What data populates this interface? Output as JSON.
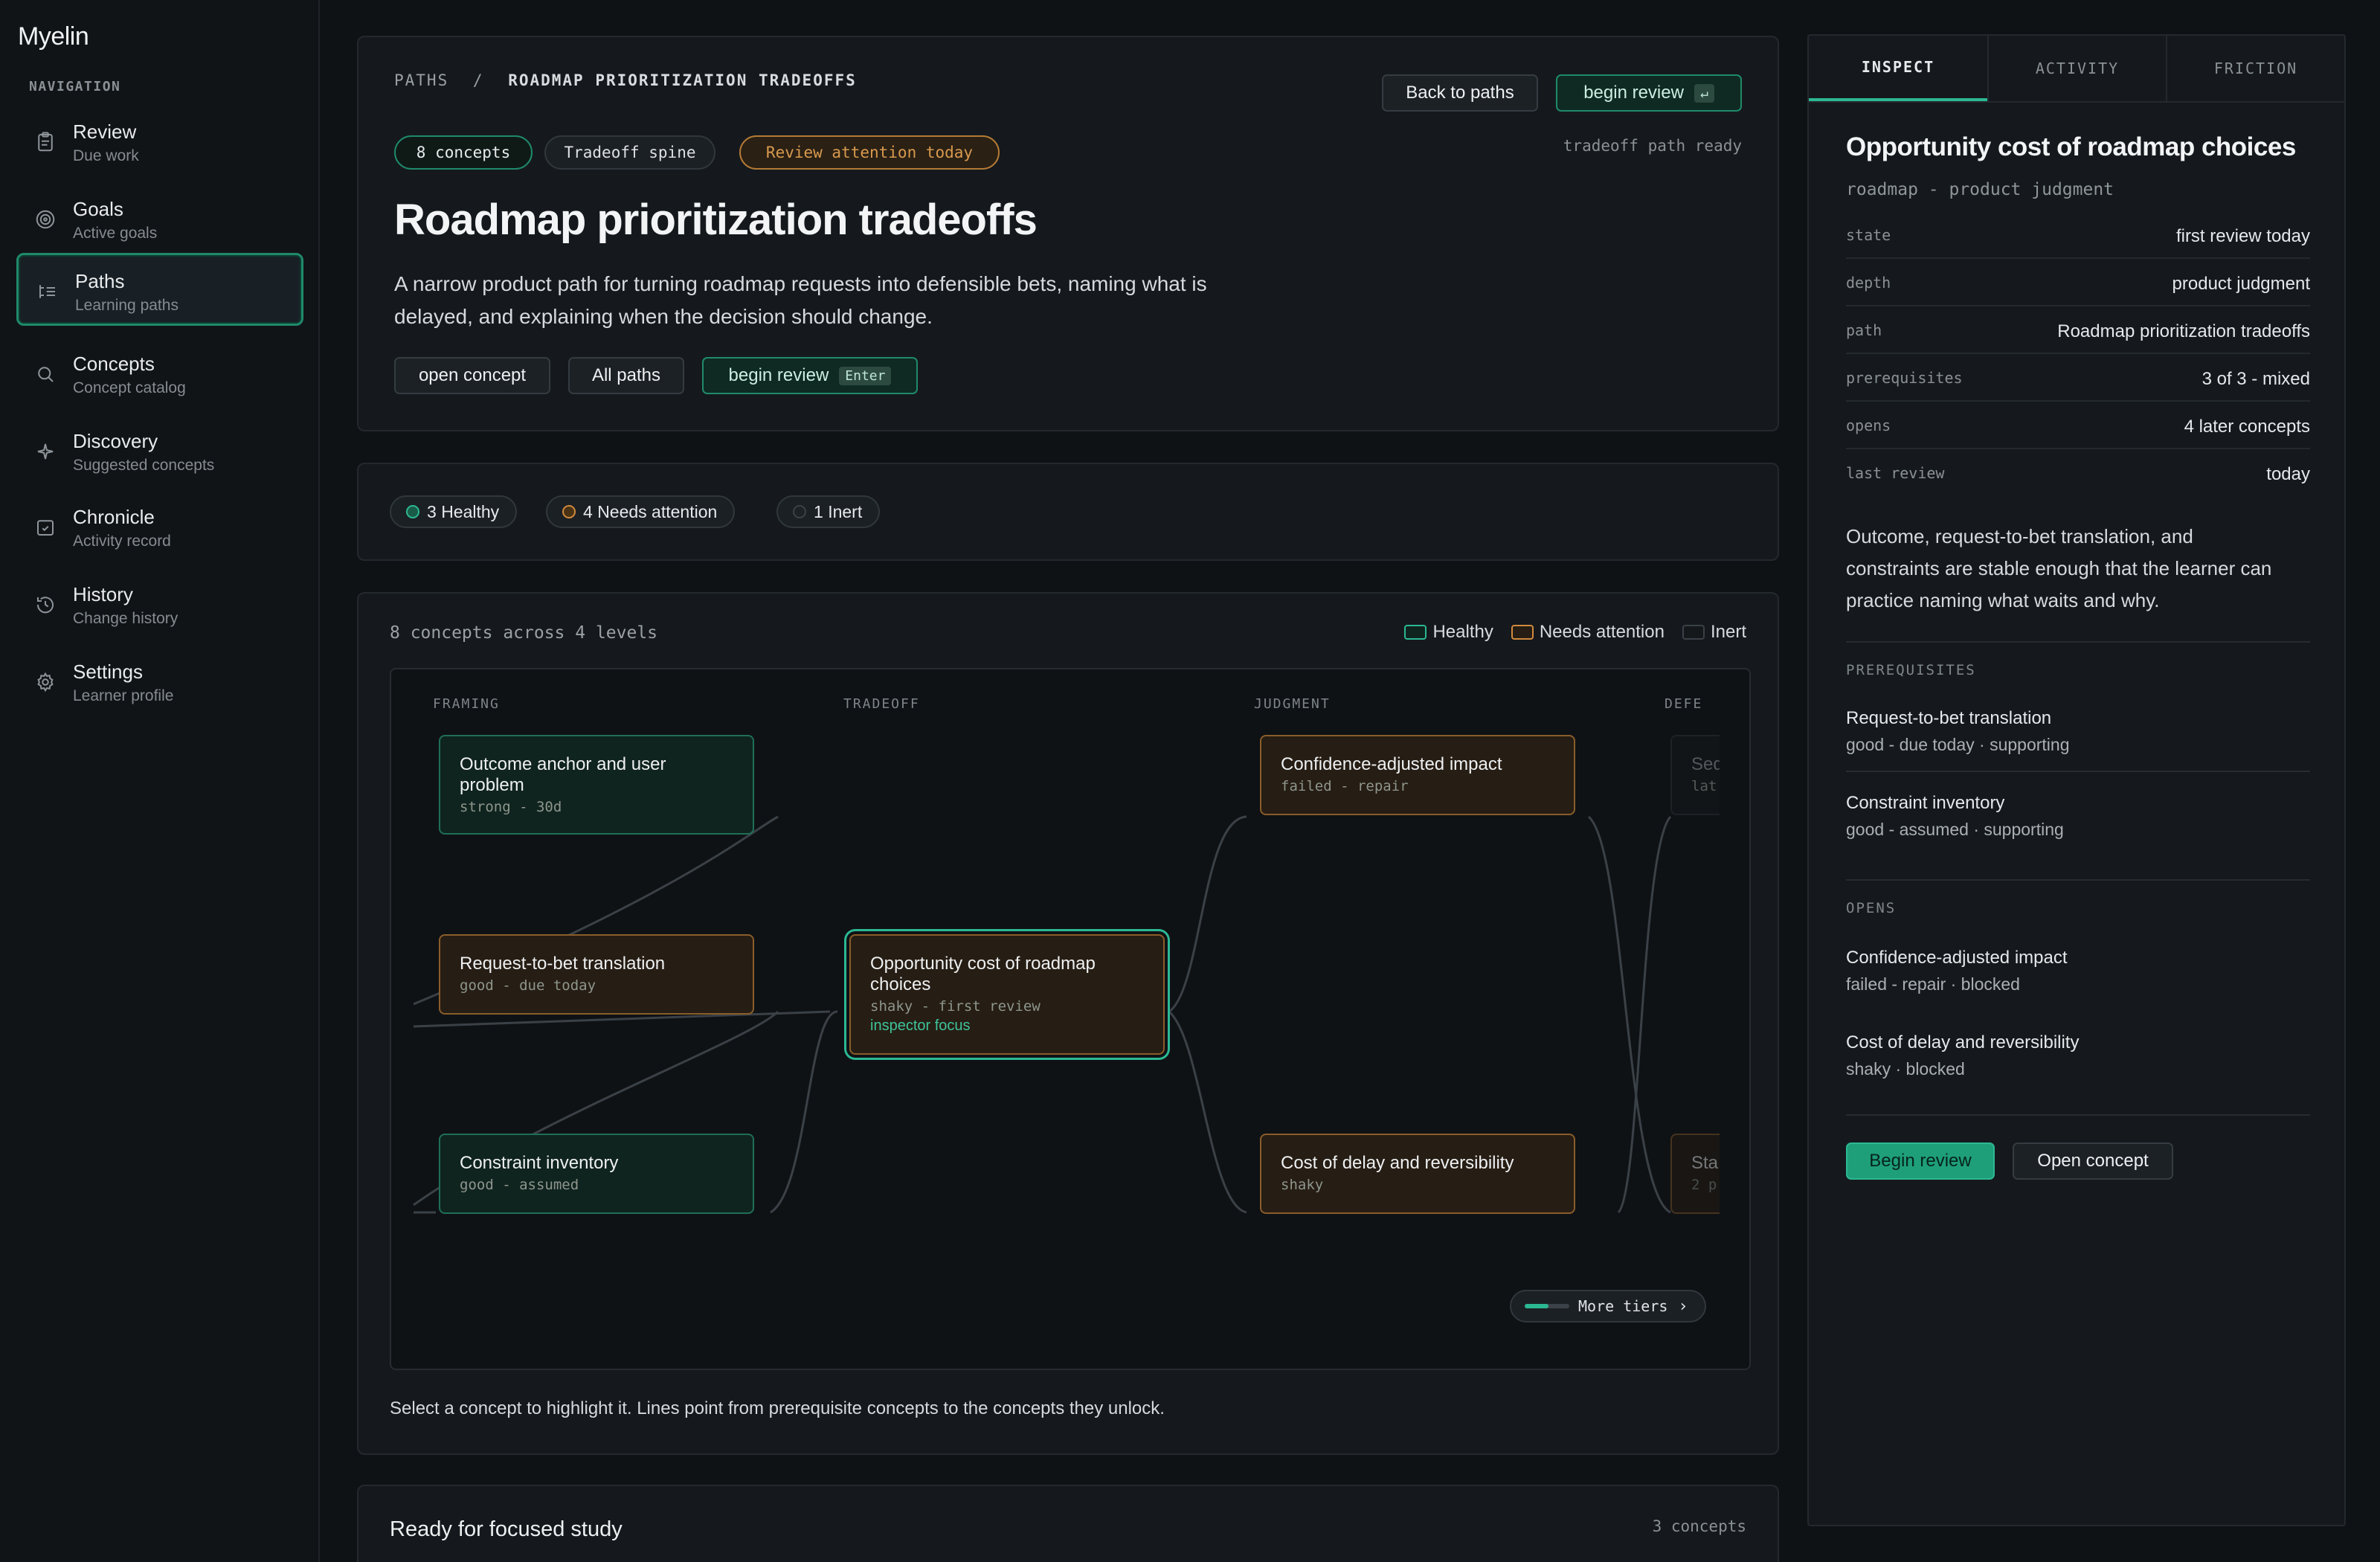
{
  "app": {
    "name": "Myelin"
  },
  "sidebar": {
    "heading": "NAVIGATION",
    "items": [
      {
        "label": "Review",
        "sub": "Due work"
      },
      {
        "label": "Goals",
        "sub": "Active goals"
      },
      {
        "label": "Paths",
        "sub": "Learning paths"
      },
      {
        "label": "Concepts",
        "sub": "Concept catalog"
      },
      {
        "label": "Discovery",
        "sub": "Suggested concepts"
      },
      {
        "label": "Chronicle",
        "sub": "Activity record"
      },
      {
        "label": "History",
        "sub": "Change history"
      },
      {
        "label": "Settings",
        "sub": "Learner profile"
      }
    ]
  },
  "header": {
    "breadcrumb_root": "PATHS",
    "breadcrumb_sep": "/",
    "breadcrumb_current": "ROADMAP PRIORITIZATION TRADEOFFS",
    "back_label": "Back to paths",
    "begin_label": "begin review",
    "begin_key": "↵",
    "status_text": "tradeoff path ready",
    "chips": [
      "8 concepts",
      "Tradeoff spine",
      "Review attention today"
    ],
    "title": "Roadmap prioritization tradeoffs",
    "description_1": "A narrow product path for turning roadmap requests into defensible bets, naming what is",
    "description_2": "delayed, and explaining when the decision should change.",
    "open_concept_label": "open concept",
    "all_paths_label": "All paths",
    "begin_review_label": "begin review",
    "begin_review_key": "Enter"
  },
  "health": {
    "healthy_count": "3",
    "healthy_label": "Healthy",
    "attention_count": "4",
    "attention_label": "Needs attention",
    "inert_count": "1",
    "inert_label": "Inert"
  },
  "graph": {
    "summary": "8 concepts across 4 levels",
    "legend": [
      "Healthy",
      "Needs attention",
      "Inert"
    ],
    "columns": [
      "FRAMING",
      "TRADEOFF",
      "JUDGMENT",
      "DEFE"
    ],
    "nodes": [
      {
        "title_1": "Outcome anchor and user",
        "title_2": "problem",
        "sub": "strong - 30d"
      },
      {
        "title_1": "Request-to-bet translation",
        "sub": "good - due today"
      },
      {
        "title_1": "Constraint inventory",
        "sub": "good - assumed"
      },
      {
        "title_1": "Opportunity cost of roadmap",
        "title_2": "choices",
        "sub": "shaky - first review",
        "focus": "inspector focus"
      },
      {
        "title_1": "Confidence-adjusted impact",
        "sub": "failed - repair"
      },
      {
        "title_1": "Cost of delay and reversibility",
        "sub": "shaky"
      },
      {
        "title_1": "Seq",
        "sub": "lat"
      },
      {
        "title_1": "Sta",
        "sub": "2 p"
      }
    ],
    "more_tiers": "More tiers",
    "caption": "Select a concept to highlight it. Lines point from prerequisite concepts to the concepts they unlock."
  },
  "focused": {
    "title": "Ready for focused study",
    "count": "3 concepts"
  },
  "inspector": {
    "tabs": [
      "INSPECT",
      "ACTIVITY",
      "FRICTION"
    ],
    "title": "Opportunity cost of roadmap choices",
    "subtitle": "roadmap - product judgment",
    "rows": [
      {
        "key": "state",
        "value": "first review today"
      },
      {
        "key": "depth",
        "value": "product judgment"
      },
      {
        "key": "path",
        "value": "Roadmap prioritization tradeoffs"
      },
      {
        "key": "prerequisites",
        "value": "3 of 3 - mixed"
      },
      {
        "key": "opens",
        "value": "4 later concepts"
      },
      {
        "key": "last review",
        "value": "today"
      }
    ],
    "summary_1": "Outcome, request-to-bet translation, and",
    "summary_2": "constraints are stable enough that the learner can",
    "summary_3": "practice naming what waits and why.",
    "prereq_heading": "PREREQUISITES",
    "prereqs": [
      {
        "title": "Request-to-bet translation",
        "sub": "good - due today · supporting"
      },
      {
        "title": "Constraint inventory",
        "sub": "good - assumed · supporting"
      }
    ],
    "opens_heading": "OPENS",
    "opens": [
      {
        "title": "Confidence-adjusted impact",
        "sub": "failed - repair · blocked"
      },
      {
        "title": "Cost of delay and reversibility",
        "sub": "shaky · blocked"
      }
    ],
    "begin_label": "Begin review",
    "open_label": "Open concept"
  },
  "colors": {
    "accent": "#2bb893",
    "attention": "#d08a3e",
    "background": "#0f1215"
  }
}
